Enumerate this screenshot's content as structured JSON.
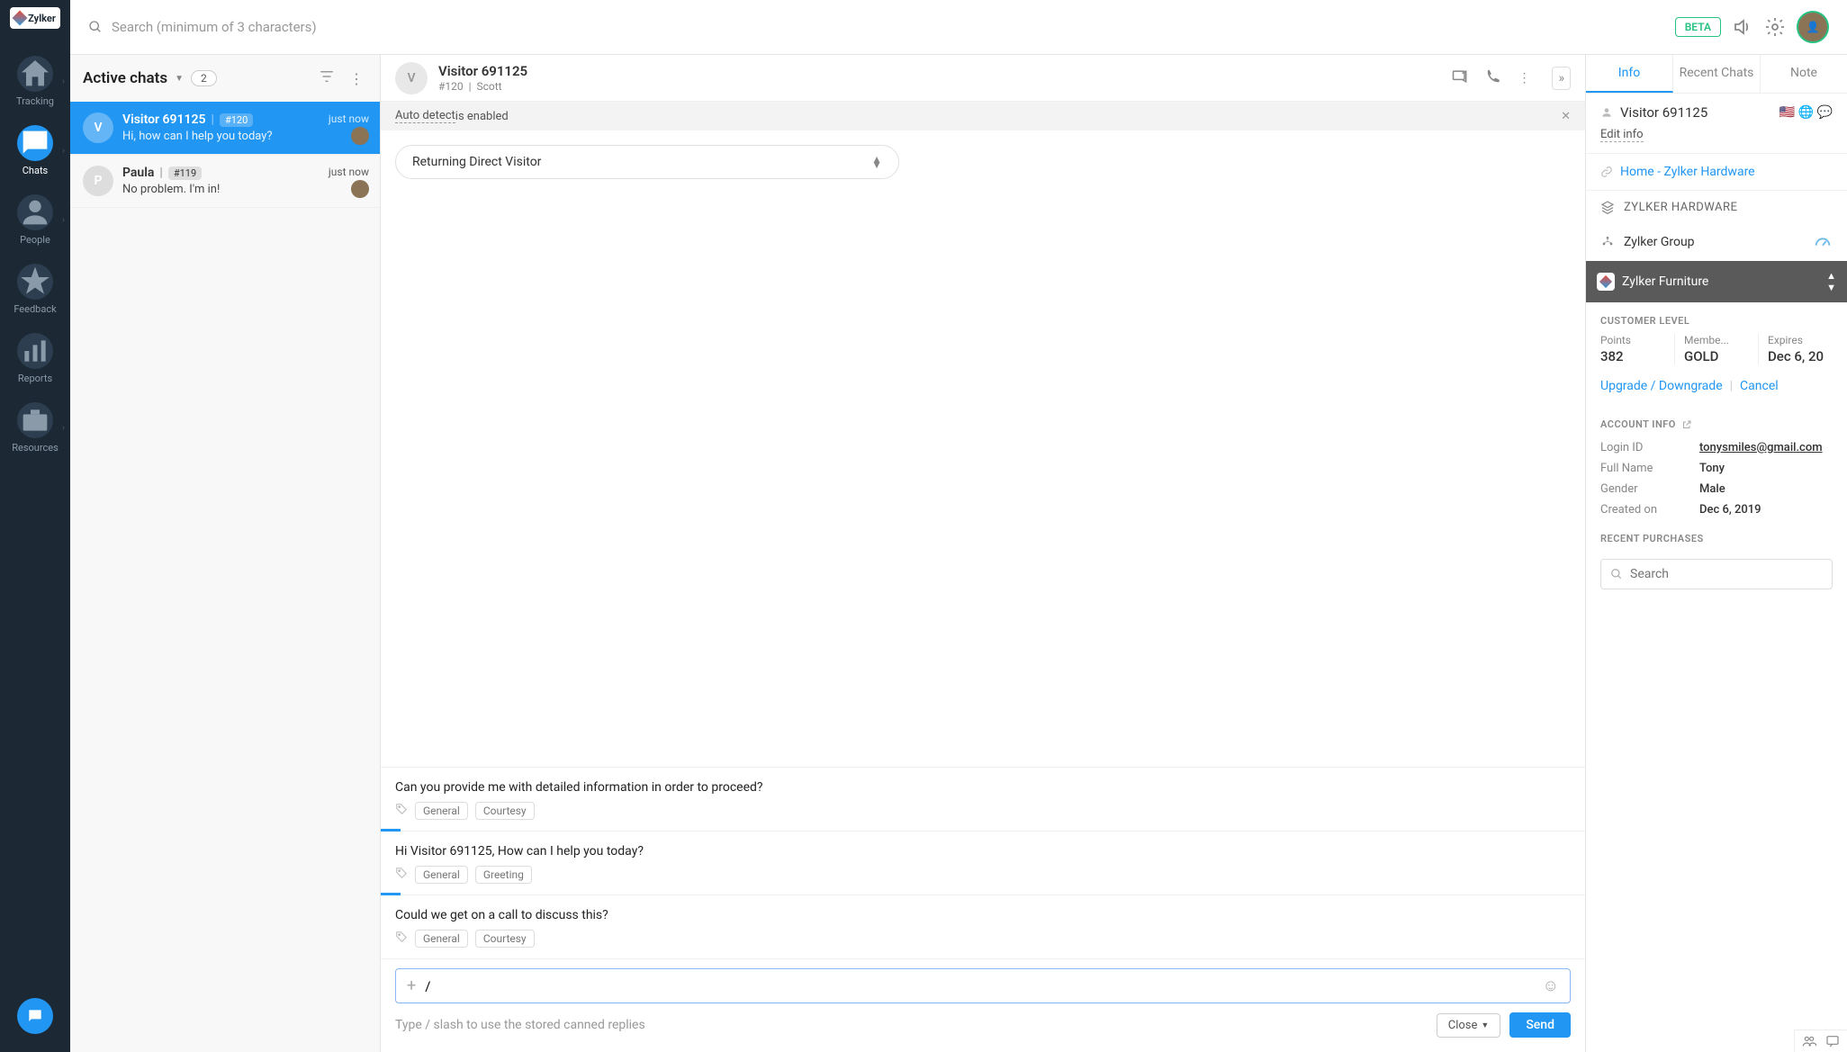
{
  "brand": "Zylker",
  "topbar": {
    "search_placeholder": "Search (minimum of 3 characters)",
    "beta": "BETA"
  },
  "sidebar": {
    "items": [
      {
        "label": "Tracking",
        "icon": "home"
      },
      {
        "label": "Chats",
        "icon": "chat",
        "active": true
      },
      {
        "label": "People",
        "icon": "person"
      },
      {
        "label": "Feedback",
        "icon": "star"
      },
      {
        "label": "Reports",
        "icon": "bar"
      },
      {
        "label": "Resources",
        "icon": "briefcase"
      }
    ]
  },
  "chatlist": {
    "title": "Active chats",
    "count": "2",
    "items": [
      {
        "name": "Visitor 691125",
        "id": "#120",
        "preview": "Hi, how can I help you today?",
        "time": "just now",
        "active": true,
        "initial": "V"
      },
      {
        "name": "Paula",
        "id": "#119",
        "preview": "No problem. I'm in!",
        "time": "just now",
        "initial": "P"
      }
    ]
  },
  "conversation": {
    "visitor_name": "Visitor 691125",
    "visitor_id": "#120",
    "operator": "Scott",
    "autodetect_underline": "Auto detect",
    "autodetect_rest": " is enabled",
    "visitor_type": "Returning Direct Visitor",
    "canned": [
      {
        "text": "Can you provide me with detailed information in order to proceed?",
        "tags": [
          "General",
          "Courtesy"
        ],
        "marker": true
      },
      {
        "text": "Hi Visitor 691125, How can I help you today?",
        "tags": [
          "General",
          "Greeting"
        ],
        "marker": true
      },
      {
        "text": "Could we get on a call to discuss this?",
        "tags": [
          "General",
          "Courtesy"
        ]
      }
    ],
    "input_value": "/",
    "hint": "Type / slash to use the stored canned replies",
    "close": "Close",
    "send": "Send"
  },
  "sidepanel": {
    "tabs": [
      "Info",
      "Recent Chats",
      "Note"
    ],
    "visitor_name": "Visitor 691125",
    "edit": "Edit info",
    "link_text": "Home - Zylker Hardware",
    "hardware": "ZYLKER HARDWARE",
    "group": "Zylker Group",
    "furniture": "Zylker Furniture",
    "customer_level": "CUSTOMER LEVEL",
    "stats": {
      "points_label": "Points",
      "points": "382",
      "member_label": "Membe...",
      "member": "GOLD",
      "expires_label": "Expires",
      "expires": "Dec 6, 20"
    },
    "upgrade": "Upgrade / Downgrade",
    "cancel": "Cancel",
    "account_info": "ACCOUNT INFO",
    "account": {
      "login_label": "Login ID",
      "login": "tonysmiles@gmail.com",
      "name_label": "Full Name",
      "name": "Tony",
      "gender_label": "Gender",
      "gender": "Male",
      "created_label": "Created on",
      "created": "Dec 6, 2019"
    },
    "recent": "RECENT PURCHASES",
    "search_placeholder": "Search"
  }
}
